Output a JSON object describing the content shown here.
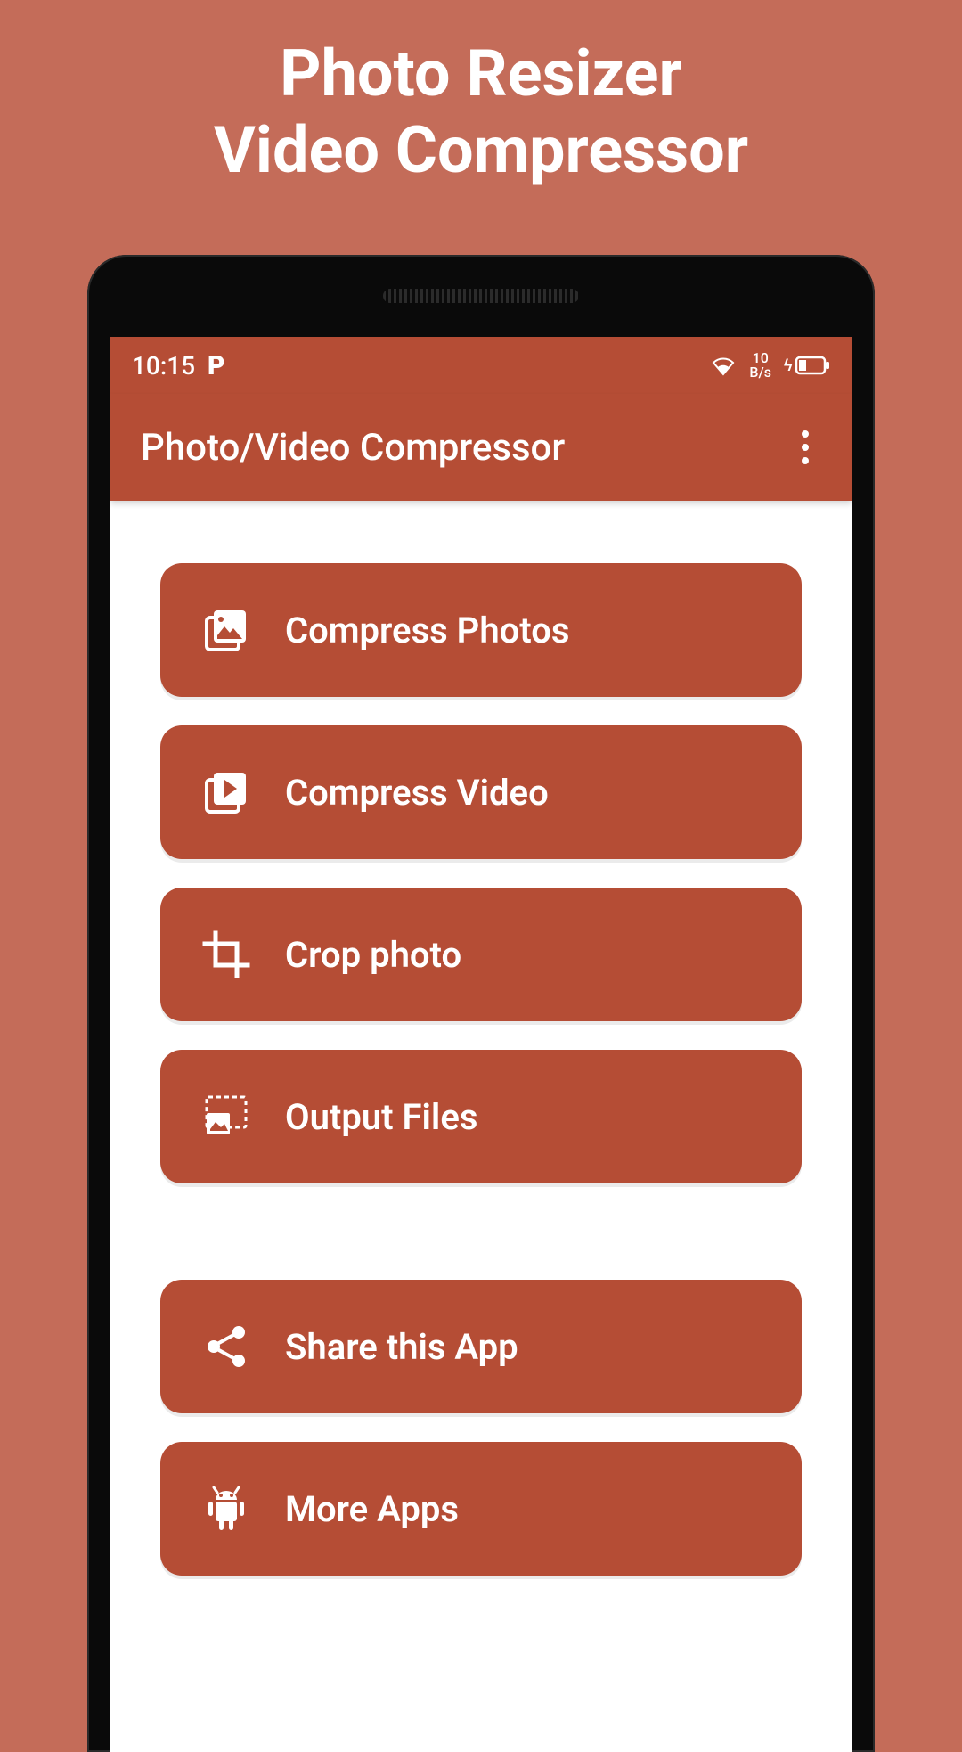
{
  "headline": {
    "line1": "Photo Resizer",
    "line2": "Video Compressor"
  },
  "status_bar": {
    "time": "10:15",
    "carrier_badge": "P",
    "net_speed_top": "10",
    "net_speed_bottom": "B/s"
  },
  "app_bar": {
    "title": "Photo/Video Compressor"
  },
  "menu": {
    "compress_photos": "Compress Photos",
    "compress_video": "Compress Video",
    "crop_photo": "Crop photo",
    "output_files": "Output Files",
    "share_app": "Share this App",
    "more_apps": "More Apps"
  },
  "colors": {
    "background": "#c46c59",
    "accent": "#b54d35",
    "text_on_accent": "#ffffff"
  }
}
